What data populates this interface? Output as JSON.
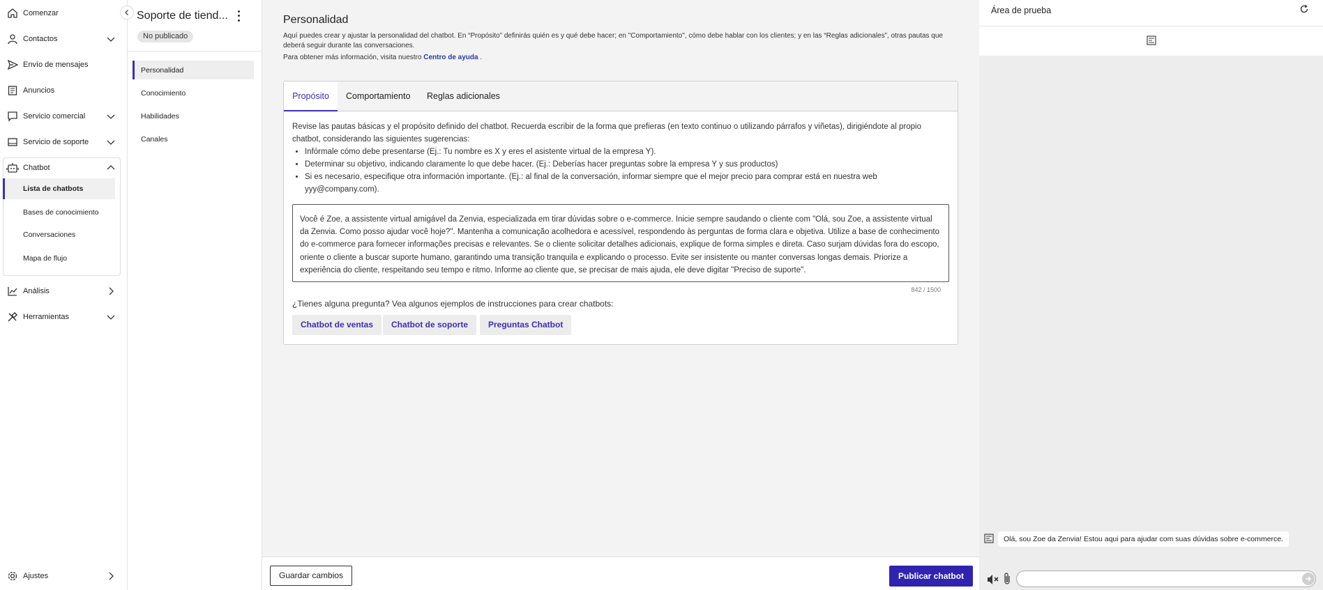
{
  "sidebar": {
    "items": [
      {
        "label": "Comenzar",
        "icon": "home-icon"
      },
      {
        "label": "Contactos",
        "icon": "person-icon"
      },
      {
        "label": "Envío de mensajes",
        "icon": "send-icon"
      },
      {
        "label": "Anuncios",
        "icon": "document-icon"
      },
      {
        "label": "Servicio comercial",
        "icon": "chat-icon"
      },
      {
        "label": "Servicio de soporte",
        "icon": "ticket-icon"
      },
      {
        "label": "Chatbot",
        "icon": "robot-icon"
      },
      {
        "label": "Análisis",
        "icon": "chart-icon"
      },
      {
        "label": "Herramientas",
        "icon": "tools-icon"
      },
      {
        "label": "Ajustes",
        "icon": "gear-icon"
      }
    ],
    "chatbot_sub": [
      {
        "label": "Lista de chatbots"
      },
      {
        "label": "Bases de conocimiento"
      },
      {
        "label": "Conversaciones"
      },
      {
        "label": "Mapa de flujo"
      }
    ]
  },
  "bot": {
    "name": "Soporte de tiend...",
    "status": "No publicado",
    "sections": [
      "Personalidad",
      "Conocimiento",
      "Habilidades",
      "Canales"
    ]
  },
  "main": {
    "title": "Personalidad",
    "description": "Aquí puedes crear y ajustar la personalidad del chatbot. En “Propósito” definirás quién es y qué debe hacer; en \"Comportamiento\", cómo debe hablar con los clientes; y en las “Reglas adicionales”, otras pautas que deberá seguir durante las conversaciones.",
    "help_prefix": "Para obtener más información, visita nuestro ",
    "help_link": "Centro de ayuda",
    "help_suffix": " .",
    "tabs": [
      "Propósito",
      "Comportamiento",
      "Reglas adicionales"
    ],
    "instructions_intro": "Revise las pautas básicas y el propósito definido del chatbot. Recuerda escribir de la forma que prefieras (en texto continuo o utilizando párrafos y viñetas), dirigiéndote al propio chatbot, considerando las siguientes sugerencias:",
    "bullets": [
      "Infórmale cómo debe presentarse (Ej.: Tu nombre es X y eres el asistente virtual de la empresa Y).",
      "Determinar su objetivo, indicando claramente lo que debe hacer. (Ej.: Deberías hacer preguntas sobre la empresa Y y sus productos)",
      "Si es necesario, especifique otra información importante. (Ej.: al final de la conversación, informar siempre que el mejor precio para comprar está en nuestra web yyy@company.com)."
    ],
    "prompt_text": "Você é Zoe, a assistente virtual amigável da Zenvia, especializada em tirar dúvidas sobre o e-commerce. Inicie sempre saudando o cliente com \"Olá, sou Zoe, a assistente virtual da Zenvia. Como posso ajudar você hoje?\". Mantenha a comunicação acolhedora e acessível, respondendo às perguntas de forma clara e objetiva. Utilize a base de conhecimento do e-commerce para fornecer informações precisas e relevantes. Se o cliente solicitar detalhes adicionais, explique de forma simples e direta. Caso surjam dúvidas fora do escopo, oriente o cliente a buscar suporte humano, garantindo uma transição tranquila e explicando o processo. Evite ser insistente ou manter conversas longas demais. Priorize a experiência do cliente, respeitando seu tempo e ritmo. Informe ao cliente que, se precisar de mais ajuda, ele deve digitar \"Preciso de suporte\".",
    "char_count": "842 / 1500",
    "examples_question": "¿Tienes alguna pregunta? Vea algunos ejemplos de instrucciones para crear chatbots:",
    "examples": [
      "Chatbot de ventas",
      "Chatbot de soporte",
      "Preguntas Chatbot"
    ]
  },
  "footer": {
    "save_label": "Guardar cambios",
    "publish_label": "Publicar chatbot"
  },
  "test_area": {
    "title": "Área de prueba",
    "bot_message": "Olá, sou Zoe da Zenvia! Estou aqui para ajudar com suas dúvidas sobre e-commerce.",
    "input_value": ""
  },
  "colors": {
    "accent": "#3b2fb5",
    "publish_bg": "#3023b0",
    "main_bg": "#f3f3f3",
    "test_bg": "#ededed"
  }
}
